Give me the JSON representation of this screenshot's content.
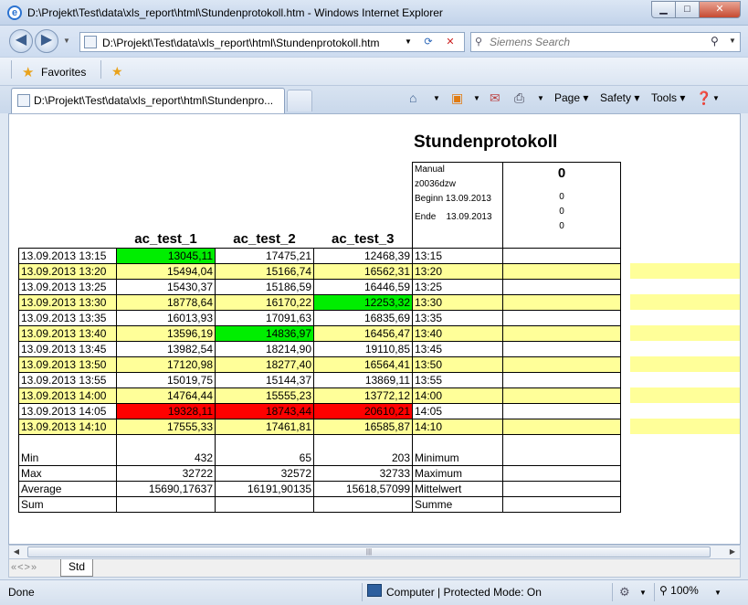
{
  "window": {
    "title": "D:\\Projekt\\Test\\data\\xls_report\\html\\Stundenprotokoll.htm - Windows Internet Explorer"
  },
  "address": {
    "url": "D:\\Projekt\\Test\\data\\xls_report\\html\\Stundenprotokoll.htm"
  },
  "search": {
    "placeholder": "Siemens Search"
  },
  "favorites": {
    "label": "Favorites"
  },
  "tab": {
    "label": "D:\\Projekt\\Test\\data\\xls_report\\html\\Stundenpro..."
  },
  "commandbar": {
    "page": "Page",
    "safety": "Safety",
    "tools": "Tools"
  },
  "report": {
    "title": "Stundenprotokoll",
    "columns": [
      "ac_test_1",
      "ac_test_2",
      "ac_test_3"
    ],
    "info": {
      "mode": "Manual",
      "user": "z0036dzw",
      "begin_label": "Beginn",
      "begin_date": "13.09.2013",
      "end_label": "Ende",
      "end_date": "13.09.2013"
    },
    "info_values": {
      "header": "0",
      "mode": "0",
      "user": "0",
      "begin": "0"
    },
    "rows": [
      {
        "ts": "13.09.2013 13:15",
        "v": [
          "13045,11",
          "17475,21",
          "12468,39"
        ],
        "t": "13:15"
      },
      {
        "ts": "13.09.2013 13:20",
        "v": [
          "15494,04",
          "15166,74",
          "16562,31"
        ],
        "t": "13:20"
      },
      {
        "ts": "13.09.2013 13:25",
        "v": [
          "15430,37",
          "15186,59",
          "16446,59"
        ],
        "t": "13:25"
      },
      {
        "ts": "13.09.2013 13:30",
        "v": [
          "18778,64",
          "16170,22",
          "12253,32"
        ],
        "t": "13:30"
      },
      {
        "ts": "13.09.2013 13:35",
        "v": [
          "16013,93",
          "17091,63",
          "16835,69"
        ],
        "t": "13:35"
      },
      {
        "ts": "13.09.2013 13:40",
        "v": [
          "13596,19",
          "14836,97",
          "16456,47"
        ],
        "t": "13:40"
      },
      {
        "ts": "13.09.2013 13:45",
        "v": [
          "13982,54",
          "18214,90",
          "19110,85"
        ],
        "t": "13:45"
      },
      {
        "ts": "13.09.2013 13:50",
        "v": [
          "17120,98",
          "18277,40",
          "16564,41"
        ],
        "t": "13:50"
      },
      {
        "ts": "13.09.2013 13:55",
        "v": [
          "15019,75",
          "15144,37",
          "13869,11"
        ],
        "t": "13:55"
      },
      {
        "ts": "13.09.2013 14:00",
        "v": [
          "14764,44",
          "15555,23",
          "13772,12"
        ],
        "t": "14:00"
      },
      {
        "ts": "13.09.2013 14:05",
        "v": [
          "19328,11",
          "18743,44",
          "20610,21"
        ],
        "t": "14:05"
      },
      {
        "ts": "13.09.2013 14:10",
        "v": [
          "17555,33",
          "17461,81",
          "16585,87"
        ],
        "t": "14:10"
      }
    ],
    "stats": [
      {
        "label": "Min",
        "v": [
          "432",
          "65",
          "203"
        ],
        "de": "Minimum"
      },
      {
        "label": "Max",
        "v": [
          "32722",
          "32572",
          "32733"
        ],
        "de": "Maximum"
      },
      {
        "label": "Average",
        "v": [
          "15690,17637",
          "16191,90135",
          "15618,57099"
        ],
        "de": "Mittelwert"
      },
      {
        "label": "Sum",
        "v": [
          "",
          "",
          ""
        ],
        "de": "Summe"
      }
    ]
  },
  "colors": {
    "row_alt": "#ffff99",
    "low": "#00ee00",
    "high": "#ff0000"
  },
  "sheet_tabs": {
    "active": "Std"
  },
  "status": {
    "text": "Done",
    "zone": "Computer | Protected Mode: On",
    "zoom": "100%"
  }
}
